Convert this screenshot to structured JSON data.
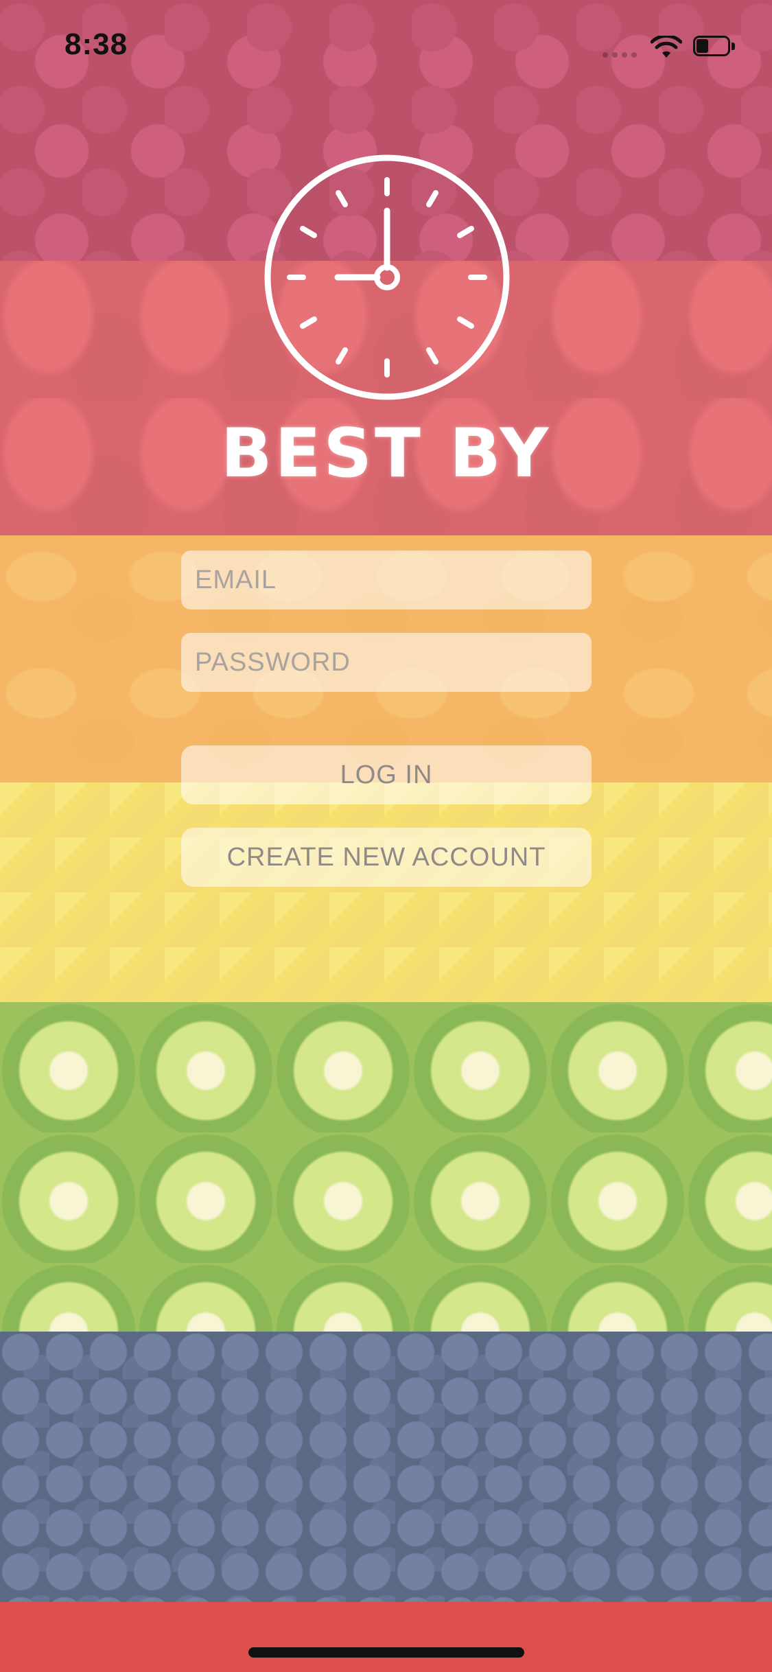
{
  "status_bar": {
    "time": "8:38",
    "icons": [
      "signal-icon",
      "wifi-icon",
      "battery-icon"
    ]
  },
  "branding": {
    "logo_icon": "clock-icon",
    "title": "BEST BY"
  },
  "login_form": {
    "email_placeholder": "EMAIL",
    "email_value": "",
    "password_placeholder": "PASSWORD",
    "password_value": "",
    "login_label": "LOG IN",
    "create_account_label": "CREATE NEW ACCOUNT"
  },
  "colors": {
    "bottom_bar": "#dd4f4c",
    "field_bg": "rgba(255,255,255,0.55)",
    "title": "#ffffff"
  }
}
